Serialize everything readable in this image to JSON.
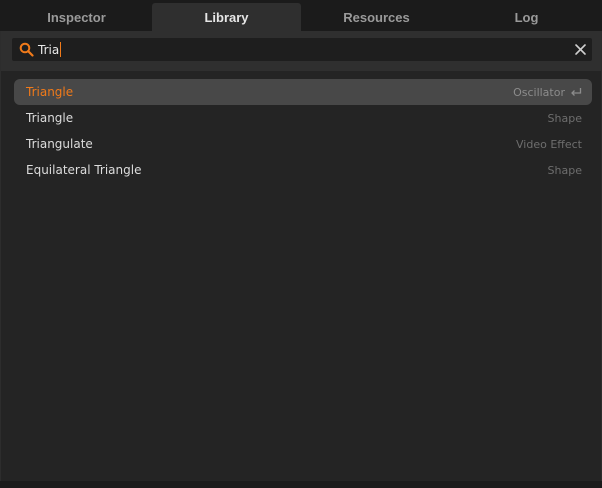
{
  "tabs": [
    {
      "label": "Inspector",
      "active": false
    },
    {
      "label": "Library",
      "active": true
    },
    {
      "label": "Resources",
      "active": false
    },
    {
      "label": "Log",
      "active": false
    }
  ],
  "search": {
    "value": "Tria",
    "icon": "search-icon",
    "clear_icon": "close-icon"
  },
  "results": [
    {
      "name": "Triangle",
      "type": "Oscillator",
      "selected": true
    },
    {
      "name": "Triangle",
      "type": "Shape",
      "selected": false
    },
    {
      "name": "Triangulate",
      "type": "Video Effect",
      "selected": false
    },
    {
      "name": "Equilateral Triangle",
      "type": "Shape",
      "selected": false
    }
  ],
  "colors": {
    "accent": "#f07a1a",
    "background": "#242424",
    "tab_active": "#2f2f2f",
    "selected_row": "#484848"
  }
}
